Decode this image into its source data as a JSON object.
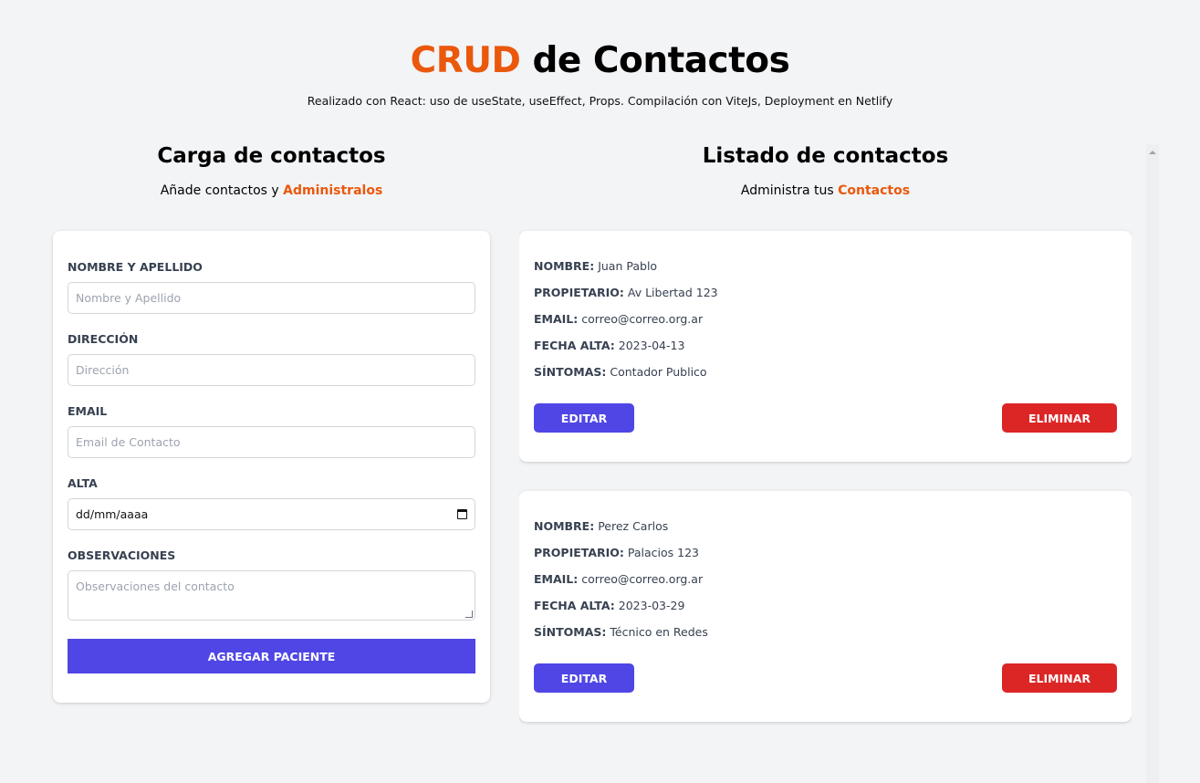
{
  "header": {
    "title_accent": "CRUD",
    "title_rest": " de Contactos",
    "subtitle": "Realizado con React: uso de useState, useEffect, Props. Compilación con ViteJs, Deployment en Netlify"
  },
  "form_section": {
    "title": "Carga de contactos",
    "sub_text": "Añade contactos y ",
    "sub_accent": "Administralos",
    "fields": {
      "name": {
        "label": "Nombre y Apellido",
        "placeholder": "Nombre y Apellido"
      },
      "address": {
        "label": "Dirección",
        "placeholder": "Dirección"
      },
      "email": {
        "label": "Email",
        "placeholder": "Email de Contacto"
      },
      "date": {
        "label": "Alta",
        "value": "dd/mm/aaaa"
      },
      "notes": {
        "label": "Observaciones",
        "placeholder": "Observaciones del contacto"
      }
    },
    "submit_label": "Agregar Paciente"
  },
  "list_section": {
    "title": "Listado de contactos",
    "sub_text": "Administra tus ",
    "sub_accent": "Contactos",
    "labels": {
      "name": "Nombre:",
      "owner": "Propietario:",
      "email": "Email:",
      "date": "Fecha Alta:",
      "symptoms": "Síntomas:"
    },
    "edit_label": "Editar",
    "delete_label": "Eliminar",
    "contacts": [
      {
        "name": "Juan Pablo",
        "owner": "Av Libertad 123",
        "email": "correo@correo.org.ar",
        "date": "2023-04-13",
        "symptoms": "Contador Publico"
      },
      {
        "name": "Perez Carlos",
        "owner": "Palacios 123",
        "email": "correo@correo.org.ar",
        "date": "2023-03-29",
        "symptoms": "Técnico en Redes"
      }
    ]
  },
  "colors": {
    "accent": "#ea580c",
    "primary": "#4f46e5",
    "danger": "#dc2626",
    "background": "#f3f4f6"
  },
  "icons": {
    "date_picker": "calendar-icon",
    "scroll_up": "triangle-up-icon"
  }
}
